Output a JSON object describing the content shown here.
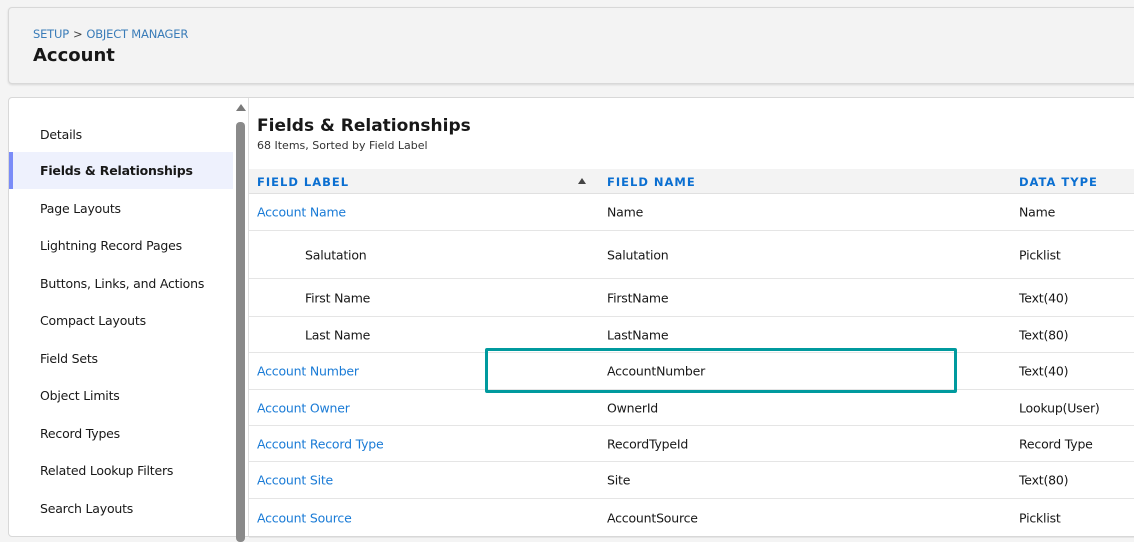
{
  "header": {
    "breadcrumb": [
      "SETUP",
      "OBJECT MANAGER"
    ],
    "separator": ">",
    "title": "Account"
  },
  "sidebar": {
    "items": [
      {
        "label": "Details"
      },
      {
        "label": "Fields & Relationships",
        "active": true
      },
      {
        "label": "Page Layouts"
      },
      {
        "label": "Lightning Record Pages"
      },
      {
        "label": "Buttons, Links, and Actions"
      },
      {
        "label": "Compact Layouts"
      },
      {
        "label": "Field Sets"
      },
      {
        "label": "Object Limits"
      },
      {
        "label": "Record Types"
      },
      {
        "label": "Related Lookup Filters"
      },
      {
        "label": "Search Layouts"
      }
    ]
  },
  "main": {
    "title": "Fields & Relationships",
    "subtitle": "68 Items, Sorted by Field Label",
    "columns": [
      "FIELD LABEL",
      "FIELD NAME",
      "DATA TYPE"
    ],
    "rows": [
      {
        "label": "Account Name",
        "name": "Name",
        "type": "Name",
        "link": true
      },
      {
        "label": "Salutation",
        "name": "Salutation",
        "type": "Picklist",
        "link": false
      },
      {
        "label": "First Name",
        "name": "FirstName",
        "type": "Text(40)",
        "link": false
      },
      {
        "label": "Last Name",
        "name": "LastName",
        "type": "Text(80)",
        "link": false
      },
      {
        "label": "Account Number",
        "name": "AccountNumber",
        "type": "Text(40)",
        "link": true,
        "highlighted": true
      },
      {
        "label": "Account Owner",
        "name": "OwnerId",
        "type": "Lookup(User)",
        "link": true
      },
      {
        "label": "Account Record Type",
        "name": "RecordTypeId",
        "type": "Record Type",
        "link": true
      },
      {
        "label": "Account Site",
        "name": "Site",
        "type": "Text(80)",
        "link": true
      },
      {
        "label": "Account Source",
        "name": "AccountSource",
        "type": "Picklist",
        "link": true
      }
    ]
  },
  "colors": {
    "link": "#1a7bd6",
    "highlight": "#009a9e",
    "active_marker": "#7a8cf8"
  }
}
